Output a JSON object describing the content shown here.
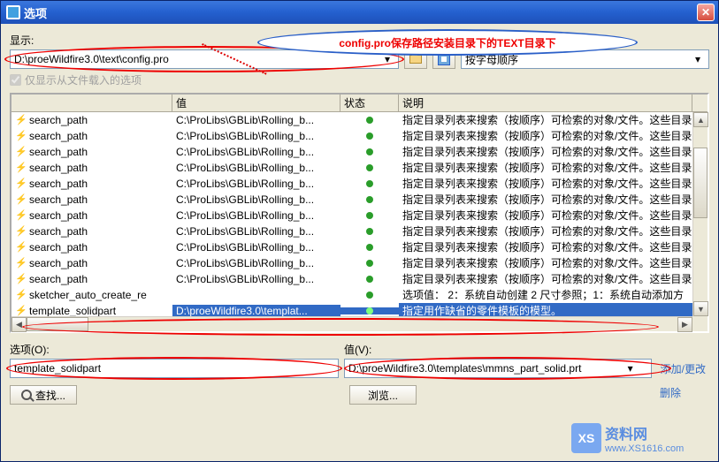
{
  "window": {
    "title": "选项"
  },
  "callout": {
    "text": "config.pro保存路径安装目录下的TEXT目录下"
  },
  "labels": {
    "show": "显示:",
    "checkbox": "仅显示从文件载入的选项",
    "option": "选项(O):",
    "value": "值(V):"
  },
  "path_field": "D:\\proeWildfire3.0\\text\\config.pro",
  "sort_field": "按字母顺序",
  "columns": {
    "name": "",
    "value": "值",
    "status": "状态",
    "desc": "说明"
  },
  "rows": [
    {
      "name": "search_path",
      "value": "C:\\ProLibs\\GBLib\\Rolling_b...",
      "desc": "指定目录列表来搜索（按顺序）可检索的对象/文件。这些目录"
    },
    {
      "name": "search_path",
      "value": "C:\\ProLibs\\GBLib\\Rolling_b...",
      "desc": "指定目录列表来搜索（按顺序）可检索的对象/文件。这些目录"
    },
    {
      "name": "search_path",
      "value": "C:\\ProLibs\\GBLib\\Rolling_b...",
      "desc": "指定目录列表来搜索（按顺序）可检索的对象/文件。这些目录"
    },
    {
      "name": "search_path",
      "value": "C:\\ProLibs\\GBLib\\Rolling_b...",
      "desc": "指定目录列表来搜索（按顺序）可检索的对象/文件。这些目录"
    },
    {
      "name": "search_path",
      "value": "C:\\ProLibs\\GBLib\\Rolling_b...",
      "desc": "指定目录列表来搜索（按顺序）可检索的对象/文件。这些目录"
    },
    {
      "name": "search_path",
      "value": "C:\\ProLibs\\GBLib\\Rolling_b...",
      "desc": "指定目录列表来搜索（按顺序）可检索的对象/文件。这些目录"
    },
    {
      "name": "search_path",
      "value": "C:\\ProLibs\\GBLib\\Rolling_b...",
      "desc": "指定目录列表来搜索（按顺序）可检索的对象/文件。这些目录"
    },
    {
      "name": "search_path",
      "value": "C:\\ProLibs\\GBLib\\Rolling_b...",
      "desc": "指定目录列表来搜索（按顺序）可检索的对象/文件。这些目录"
    },
    {
      "name": "search_path",
      "value": "C:\\ProLibs\\GBLib\\Rolling_b...",
      "desc": "指定目录列表来搜索（按顺序）可检索的对象/文件。这些目录"
    },
    {
      "name": "search_path",
      "value": "C:\\ProLibs\\GBLib\\Rolling_b...",
      "desc": "指定目录列表来搜索（按顺序）可检索的对象/文件。这些目录"
    },
    {
      "name": "search_path",
      "value": "C:\\ProLibs\\GBLib\\Rolling_b...",
      "desc": "指定目录列表来搜索（按顺序）可检索的对象/文件。这些目录"
    },
    {
      "name": "sketcher_auto_create_re",
      "value": "",
      "desc": "选项值： 2：系统自动创建 2 尺寸参照；1：系统自动添加方"
    }
  ],
  "highlight_row": {
    "name": "template_solidpart",
    "value": "D:\\proeWildfire3.0\\templat...",
    "desc": "指定用作缺省的零件模板的模型。"
  },
  "option_input": "template_solidpart",
  "value_input": "D:\\proeWildfire3.0\\templates\\mmns_part_solid.prt",
  "links": {
    "add": "添加/更改",
    "delete": "删除"
  },
  "buttons": {
    "find": "查找...",
    "browse": "浏览..."
  },
  "watermark": {
    "logo": "XS",
    "t1": "资料网",
    "t2": "www.XS1616.com"
  }
}
